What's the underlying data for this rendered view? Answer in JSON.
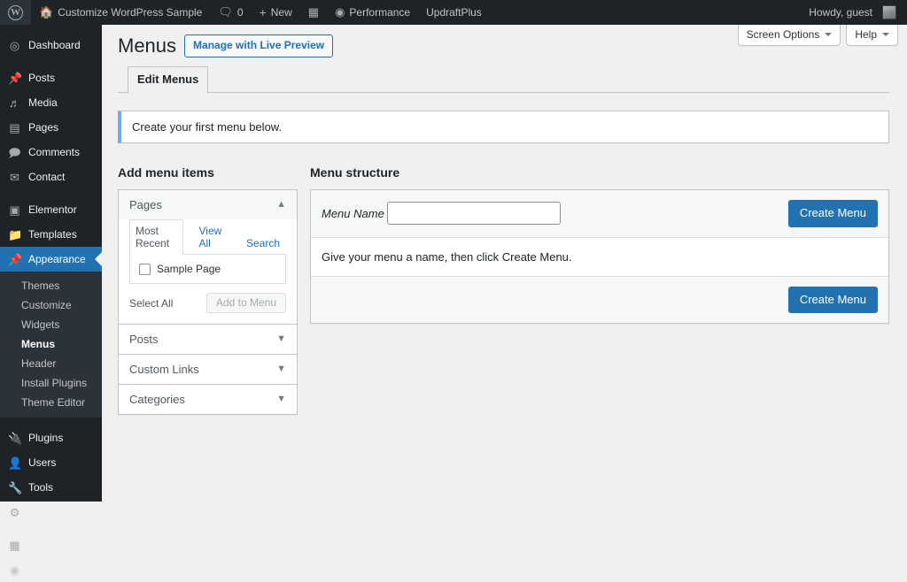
{
  "adminbar": {
    "logo_icon": "wordpress-logo-icon",
    "site_icon": "home-icon",
    "site_name": "Customize WordPress Sample",
    "comments_icon": "comment-bubble-icon",
    "comments_count": "0",
    "new_icon": "plus-icon",
    "new_label": "New",
    "seo_icon": "yoast-seo-icon",
    "performance_icon": "performance-icon",
    "performance_label": "Performance",
    "updraft_label": "UpdraftPlus",
    "howdy": "Howdy, guest",
    "avatar_icon": "user-avatar"
  },
  "sidebar": {
    "items": [
      {
        "label": "Dashboard",
        "icon": "dashboard-icon",
        "glyph": "⌂",
        "name": "dashboard",
        "sep_after": true
      },
      {
        "label": "Posts",
        "icon": "pin-icon",
        "glyph": "✐",
        "name": "posts"
      },
      {
        "label": "Media",
        "icon": "media-icon",
        "glyph": "♪",
        "name": "media"
      },
      {
        "label": "Pages",
        "icon": "page-icon",
        "glyph": "▤",
        "name": "pages"
      },
      {
        "label": "Comments",
        "icon": "comment-icon",
        "glyph": "▭",
        "name": "comments"
      },
      {
        "label": "Contact",
        "icon": "envelope-icon",
        "glyph": "✉",
        "name": "contact",
        "sep_after": true
      },
      {
        "label": "Elementor",
        "icon": "elementor-icon",
        "glyph": "▣",
        "name": "elementor"
      },
      {
        "label": "Templates",
        "icon": "folder-icon",
        "glyph": "▰",
        "name": "templates"
      },
      {
        "label": "Appearance",
        "icon": "brush-icon",
        "glyph": "✐",
        "name": "appearance",
        "current": true
      }
    ],
    "submenu": [
      {
        "label": "Themes",
        "name": "themes"
      },
      {
        "label": "Customize",
        "name": "customize"
      },
      {
        "label": "Widgets",
        "name": "widgets"
      },
      {
        "label": "Menus",
        "name": "menus",
        "current": true
      },
      {
        "label": "Header",
        "name": "header"
      },
      {
        "label": "Install Plugins",
        "name": "install-plugins"
      },
      {
        "label": "Theme Editor",
        "name": "theme-editor"
      }
    ],
    "items_lower": [
      {
        "label": "Plugins",
        "icon": "plug-icon",
        "glyph": "⚒",
        "name": "plugins"
      },
      {
        "label": "Users",
        "icon": "user-icon",
        "glyph": "♟",
        "name": "users"
      },
      {
        "label": "Tools",
        "icon": "wrench-icon",
        "glyph": "⚒",
        "name": "tools"
      },
      {
        "label": "Settings",
        "icon": "gear-icon",
        "glyph": "⚙",
        "name": "settings",
        "sep_after": true
      },
      {
        "label": "SEO",
        "icon": "yoast-seo-icon",
        "glyph": "▨",
        "name": "seo"
      }
    ]
  },
  "screen_meta": {
    "screen_options": "Screen Options",
    "help": "Help"
  },
  "page": {
    "title": "Menus",
    "title_action": "Manage with Live Preview",
    "tab_edit_menus": "Edit Menus",
    "notice": "Create your first menu below."
  },
  "add_menu_items": {
    "heading": "Add menu items",
    "pages": {
      "title": "Pages",
      "arrow": "▲",
      "tabs": [
        {
          "label": "Most Recent",
          "active": true
        },
        {
          "label": "View All",
          "active": false
        },
        {
          "label": "Search",
          "active": false
        }
      ],
      "items": [
        {
          "label": "Sample Page"
        }
      ],
      "select_all": "Select All",
      "add_to_menu": "Add to Menu"
    },
    "sections": [
      {
        "title": "Posts",
        "arrow": "▼",
        "name": "posts"
      },
      {
        "title": "Custom Links",
        "arrow": "▼",
        "name": "custom-links"
      },
      {
        "title": "Categories",
        "arrow": "▼",
        "name": "categories"
      }
    ]
  },
  "menu_structure": {
    "heading": "Menu structure",
    "name_label": "Menu Name",
    "name_value": "",
    "name_placeholder": "",
    "create_button_top": "Create Menu",
    "instructions": "Give your menu a name, then click Create Menu.",
    "create_button_bottom": "Create Menu"
  }
}
